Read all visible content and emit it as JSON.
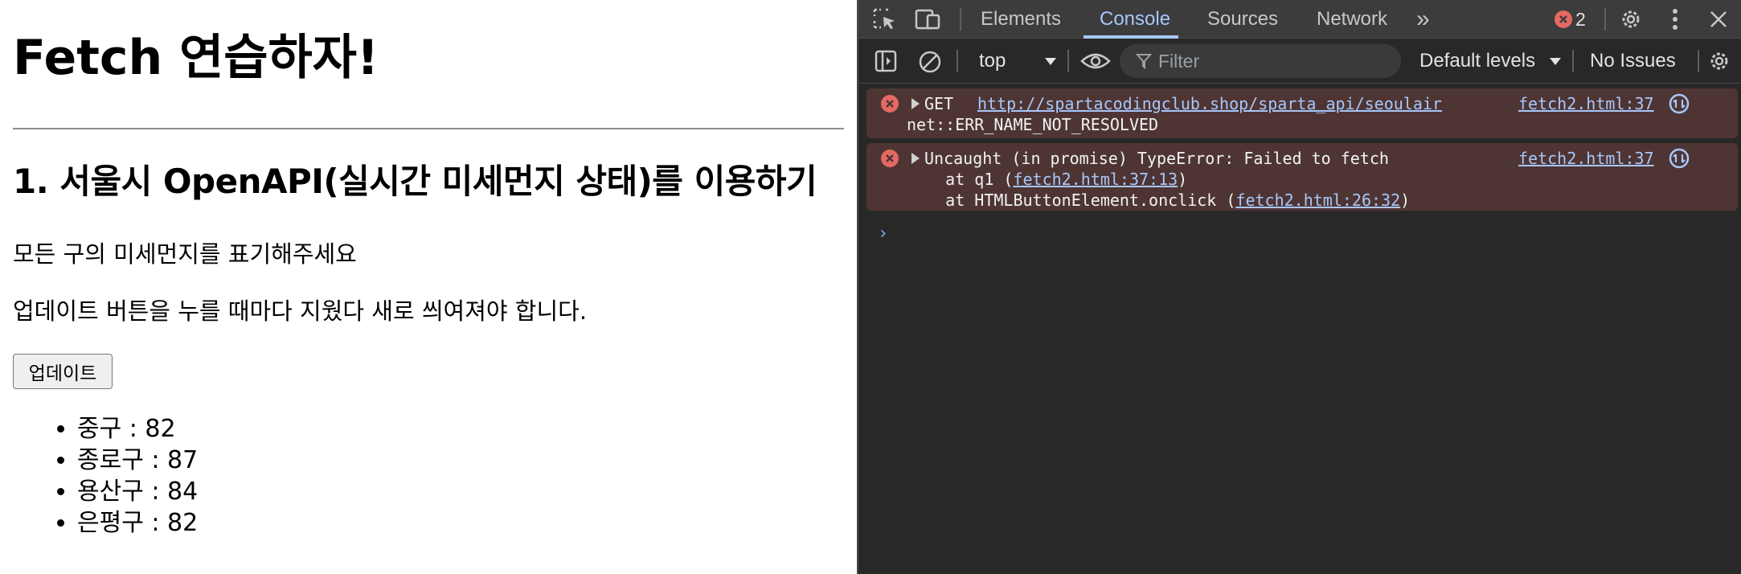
{
  "page": {
    "title": "Fetch 연습하자!",
    "section_title": "1. 서울시 OpenAPI(실시간 미세먼지 상태)를 이용하기",
    "description_1": "모든 구의 미세먼지를 표기해주세요",
    "description_2": "업데이트 버튼을 누를 때마다 지웠다 새로 씌여져야 합니다.",
    "update_button": "업데이트",
    "list_items": [
      "중구 : 82",
      "종로구 : 87",
      "용산구 : 84",
      "은평구 : 82"
    ]
  },
  "devtools": {
    "tabs": [
      "Elements",
      "Console",
      "Sources",
      "Network"
    ],
    "active_tab": "Console",
    "more_tabs_glyph": "»",
    "error_count": "2",
    "toolbar": {
      "context": "top",
      "filter_placeholder": "Filter",
      "levels": "Default levels",
      "issues": "No Issues"
    },
    "messages": [
      {
        "method": "GET",
        "url": "http://spartacodingclub.shop/sparta_api/seoulair",
        "detail": "net::ERR_NAME_NOT_RESOLVED",
        "source": "fetch2.html:37"
      },
      {
        "text": "Uncaught (in promise) TypeError: Failed to fetch",
        "stack_1_prefix": "    at q1 (",
        "stack_1_link": "fetch2.html:37:13",
        "stack_1_suffix": ")",
        "stack_2_prefix": "    at HTMLButtonElement.onclick (",
        "stack_2_link": "fetch2.html:26:32",
        "stack_2_suffix": ")",
        "source": "fetch2.html:37"
      }
    ],
    "prompt_glyph": "›",
    "colors": {
      "background": "#282828",
      "tabbar": "#3c3c3c",
      "accent": "#a8c7fa",
      "error_bg": "#4e3534",
      "error_icon": "#e46962"
    }
  }
}
